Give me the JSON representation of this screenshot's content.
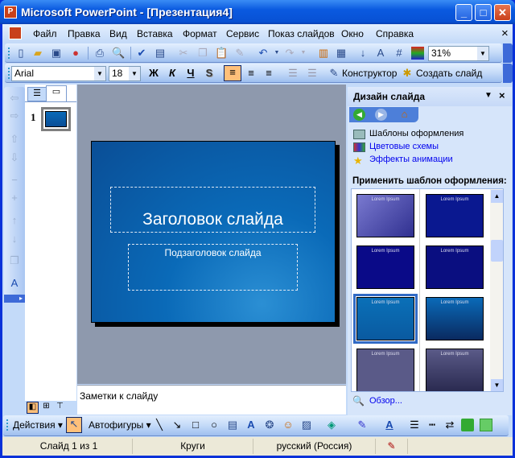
{
  "window": {
    "title": "Microsoft PowerPoint - [Презентация4]",
    "minimize": "_",
    "maximize": "□",
    "close": "✕"
  },
  "menu": [
    "Файл",
    "Правка",
    "Вид",
    "Вставка",
    "Формат",
    "Сервис",
    "Показ слайдов",
    "Окно",
    "Справка"
  ],
  "menu_close": "×",
  "standard_toolbar": {
    "zoom": "31%"
  },
  "format_toolbar": {
    "font": "Arial",
    "size": "18",
    "bold": "Ж",
    "italic": "К",
    "underline": "Ч",
    "shadow": "S",
    "designer": "Конструктор",
    "new_slide": "Создать слайд"
  },
  "outline": {
    "slide_number": "1"
  },
  "slide": {
    "title": "Заголовок слайда",
    "subtitle": "Подзаголовок слайда"
  },
  "notes": {
    "placeholder": "Заметки к слайду"
  },
  "taskpane": {
    "title": "Дизайн слайда",
    "links": [
      "Шаблоны оформления",
      "Цветовые схемы",
      "Эффекты анимации"
    ],
    "apply_label": "Применить шаблон оформления:",
    "thumb_text": "Lorem Ipsum",
    "browse": "Обзор..."
  },
  "drawing_toolbar": {
    "actions": "Действия",
    "autoshapes": "Автофигуры"
  },
  "status": {
    "slide": "Слайд 1 из 1",
    "design": "Круги",
    "language": "русский (Россия)"
  }
}
